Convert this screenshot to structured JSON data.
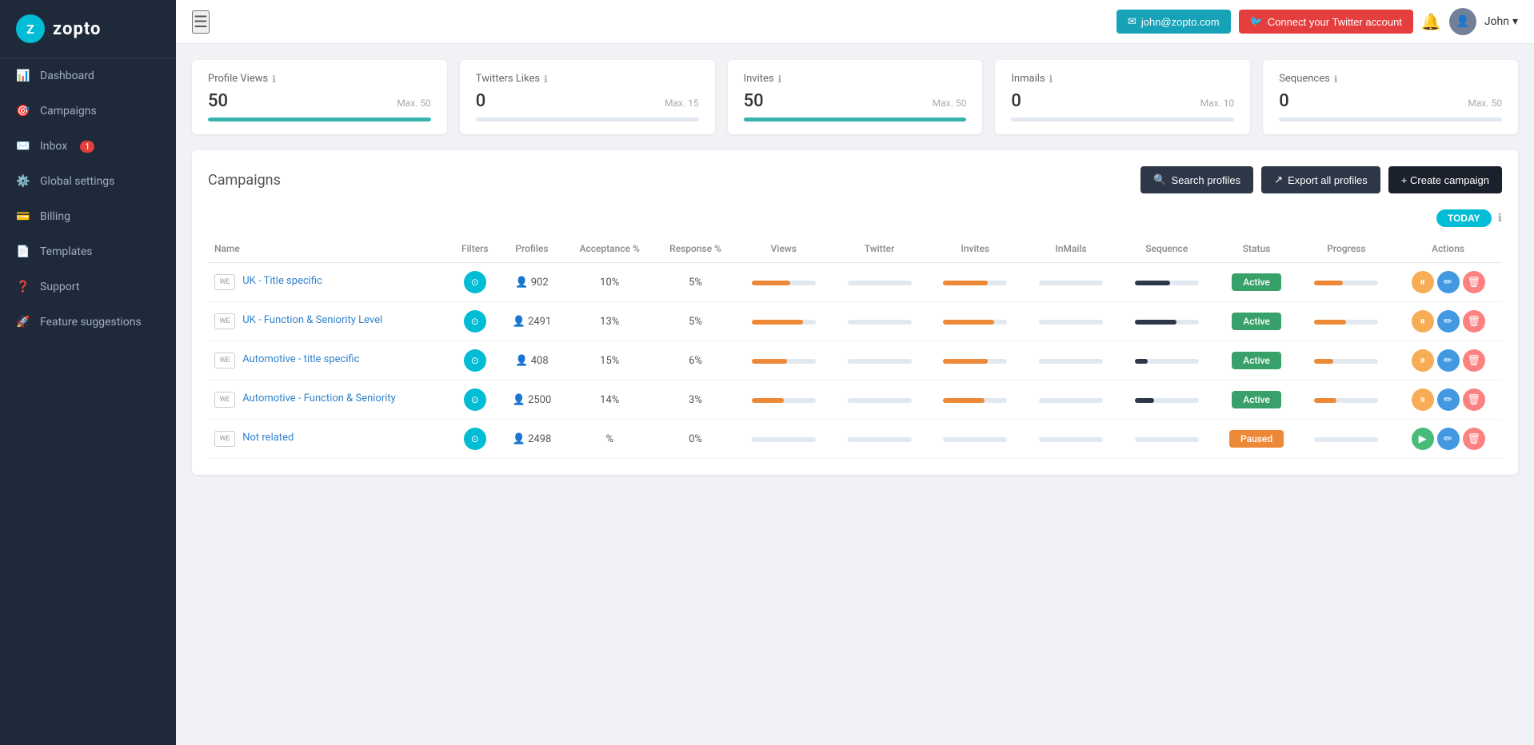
{
  "sidebar": {
    "logo": "Z",
    "logo_text": "zopto",
    "items": [
      {
        "label": "Dashboard",
        "icon": "chart-icon",
        "active": false
      },
      {
        "label": "Campaigns",
        "icon": "campaigns-icon",
        "active": false
      },
      {
        "label": "Inbox",
        "icon": "inbox-icon",
        "badge": "1",
        "active": false
      },
      {
        "label": "Global settings",
        "icon": "settings-icon",
        "active": false
      },
      {
        "label": "Billing",
        "icon": "billing-icon",
        "active": false
      },
      {
        "label": "Templates",
        "icon": "templates-icon",
        "active": false
      },
      {
        "label": "Support",
        "icon": "support-icon",
        "active": false
      },
      {
        "label": "Feature suggestions",
        "icon": "rocket-icon",
        "active": false
      }
    ]
  },
  "topbar": {
    "hamburger": "☰",
    "email_btn": "john@zopto.com",
    "twitter_btn": "Connect your Twitter account",
    "user_name": "John",
    "notif_icon": "🔔"
  },
  "stats": [
    {
      "title": "Profile Views",
      "current": "50",
      "max": "Max. 50",
      "fill_pct": 100,
      "color": "teal"
    },
    {
      "title": "Twitters Likes",
      "current": "0",
      "max": "Max. 15",
      "fill_pct": 0,
      "color": "teal"
    },
    {
      "title": "Invites",
      "current": "50",
      "max": "Max. 50",
      "fill_pct": 100,
      "color": "teal"
    },
    {
      "title": "Inmails",
      "current": "0",
      "max": "Max. 10",
      "fill_pct": 0,
      "color": "teal"
    },
    {
      "title": "Sequences",
      "current": "0",
      "max": "Max. 50",
      "fill_pct": 0,
      "color": "teal"
    }
  ],
  "campaigns": {
    "title": "Campaigns",
    "search_btn": "Search profiles",
    "export_btn": "Export all profiles",
    "create_btn": "+ Create campaign",
    "toggle_label": "TODAY",
    "table": {
      "columns": [
        "Name",
        "Filters",
        "Profiles",
        "Acceptance %",
        "Response %",
        "Views",
        "Twitter",
        "Invites",
        "InMails",
        "Sequence",
        "Status",
        "Progress",
        "Actions"
      ],
      "rows": [
        {
          "name": "UK - Title specific",
          "profiles": "902",
          "acceptance": "10%",
          "response": "5%",
          "status": "Active",
          "status_type": "active",
          "views_pct": 60,
          "twitter_pct": 0,
          "invites_pct": 70,
          "inmails_pct": 0,
          "sequence_pct": 55,
          "progress_pct": 45
        },
        {
          "name": "UK - Function & Seniority Level",
          "profiles": "2491",
          "acceptance": "13%",
          "response": "5%",
          "status": "Active",
          "status_type": "active",
          "views_pct": 80,
          "twitter_pct": 0,
          "invites_pct": 80,
          "inmails_pct": 0,
          "sequence_pct": 65,
          "progress_pct": 50
        },
        {
          "name": "Automotive - title specific",
          "profiles": "408",
          "acceptance": "15%",
          "response": "6%",
          "status": "Active",
          "status_type": "active",
          "views_pct": 55,
          "twitter_pct": 0,
          "invites_pct": 70,
          "inmails_pct": 0,
          "sequence_pct": 20,
          "progress_pct": 30
        },
        {
          "name": "Automotive - Function & Seniority",
          "profiles": "2500",
          "acceptance": "14%",
          "response": "3%",
          "status": "Active",
          "status_type": "active",
          "views_pct": 50,
          "twitter_pct": 0,
          "invites_pct": 65,
          "inmails_pct": 0,
          "sequence_pct": 30,
          "progress_pct": 35
        },
        {
          "name": "Not related",
          "profiles": "2498",
          "acceptance": "%",
          "response": "0%",
          "status": "Paused",
          "status_type": "paused",
          "views_pct": 0,
          "twitter_pct": 0,
          "invites_pct": 0,
          "inmails_pct": 0,
          "sequence_pct": 0,
          "progress_pct": 0
        }
      ]
    }
  }
}
